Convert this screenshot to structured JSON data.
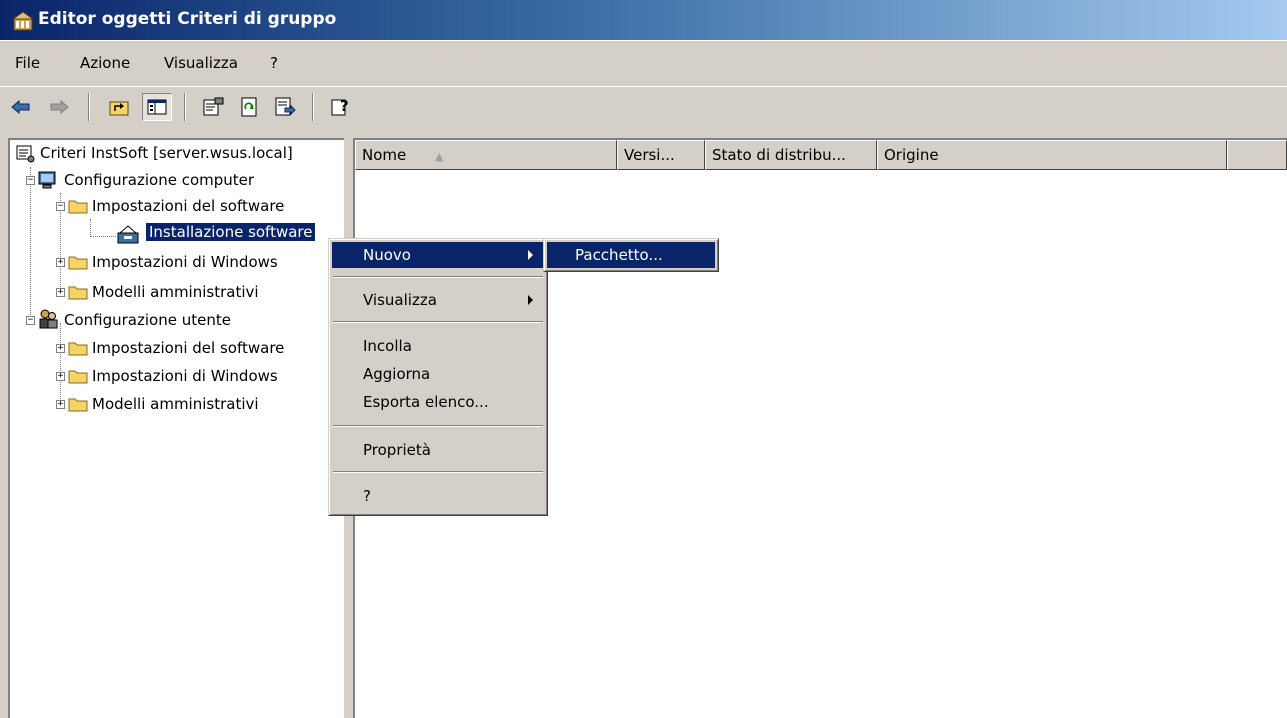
{
  "window": {
    "title": "Editor oggetti Criteri di gruppo"
  },
  "menubar": {
    "items": [
      "File",
      "Azione",
      "Visualizza",
      "?"
    ]
  },
  "toolbar": {
    "icons": [
      "back-arrow-icon",
      "forward-arrow-icon",
      "up-folder-icon",
      "show-hide-tree-icon",
      "properties-icon",
      "refresh-icon",
      "export-list-icon",
      "help-icon"
    ]
  },
  "tree": {
    "root": "Criteri InstSoft [server.wsus.local]",
    "computer": "Configurazione computer",
    "computer_software": "Impostazioni del software",
    "software_install": "Installazione software",
    "computer_windows": "Impostazioni di Windows",
    "computer_admin": "Modelli amministrativi",
    "user": "Configurazione utente",
    "user_software": "Impostazioni del software",
    "user_windows": "Impostazioni di Windows",
    "user_admin": "Modelli amministrativi"
  },
  "list": {
    "columns": [
      "Nome",
      "Versi...",
      "Stato di distribu...",
      "Origine"
    ]
  },
  "context_menu": {
    "items": [
      "Nuovo",
      "Visualizza",
      "Incolla",
      "Aggiorna",
      "Esporta elenco...",
      "Proprietà",
      "?"
    ]
  },
  "submenu": {
    "items": [
      "Pacchetto..."
    ]
  },
  "colors": {
    "highlight": "#0a246a",
    "face": "#d4d0c8",
    "folder": "#f6d365"
  }
}
